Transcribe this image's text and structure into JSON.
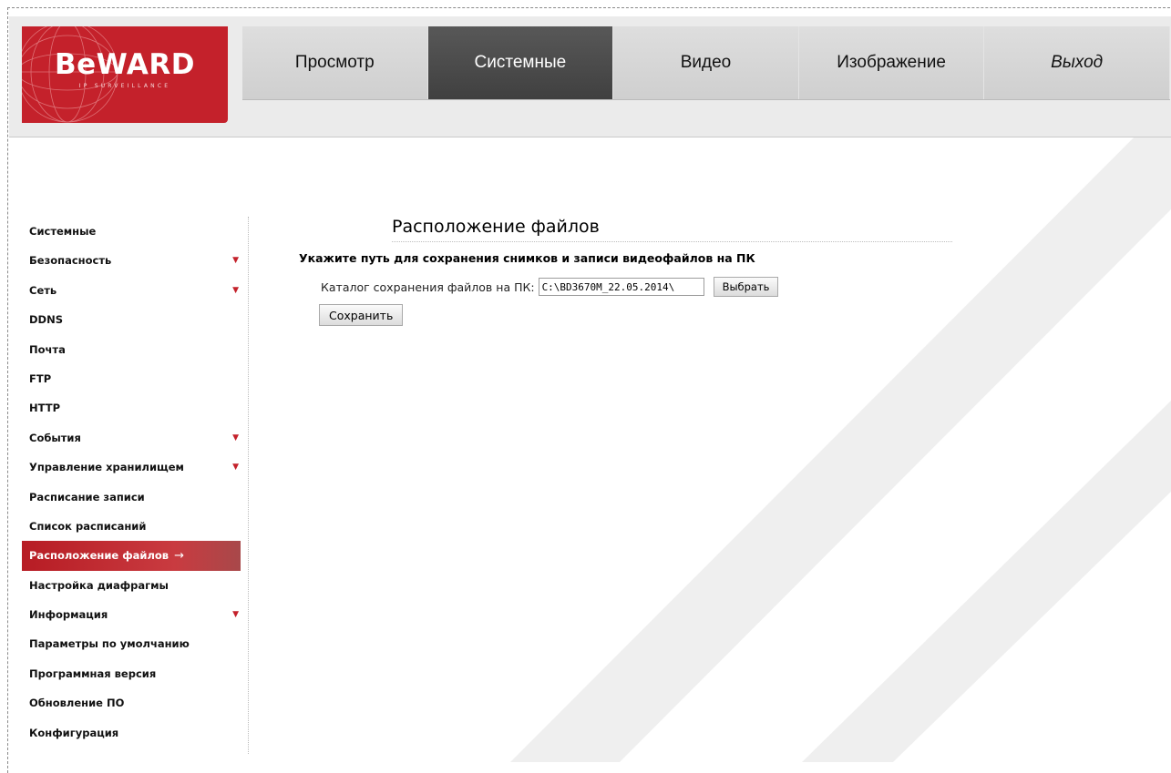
{
  "brand": {
    "logo_text": "BeWARD",
    "logo_tagline": "IP SURVEILLANCE"
  },
  "nav": {
    "tabs": [
      {
        "label": "Просмотр",
        "active": false
      },
      {
        "label": "Системные",
        "active": true
      },
      {
        "label": "Видео",
        "active": false
      },
      {
        "label": "Изображение",
        "active": false
      },
      {
        "label": "Выход",
        "active": false
      }
    ]
  },
  "sidebar": {
    "items": [
      {
        "label": "Системные",
        "has_submenu": false
      },
      {
        "label": "Безопасность",
        "has_submenu": true
      },
      {
        "label": "Сеть",
        "has_submenu": true
      },
      {
        "label": "DDNS",
        "has_submenu": false
      },
      {
        "label": "Почта",
        "has_submenu": false
      },
      {
        "label": "FTP",
        "has_submenu": false
      },
      {
        "label": "HTTP",
        "has_submenu": false
      },
      {
        "label": "События",
        "has_submenu": true
      },
      {
        "label": "Управление хранилищем",
        "has_submenu": true
      },
      {
        "label": "Расписание записи",
        "has_submenu": false
      },
      {
        "label": "Список расписаний",
        "has_submenu": false
      },
      {
        "label": "Расположение файлов",
        "has_submenu": false,
        "active": true
      },
      {
        "label": "Настройка диафрагмы",
        "has_submenu": false
      },
      {
        "label": "Информация",
        "has_submenu": true
      },
      {
        "label": "Параметры по умолчанию",
        "has_submenu": false
      },
      {
        "label": "Программная версия",
        "has_submenu": false
      },
      {
        "label": "Обновление ПО",
        "has_submenu": false
      },
      {
        "label": "Конфигурация",
        "has_submenu": false
      }
    ],
    "active_arrow": "→"
  },
  "main": {
    "title": "Расположение файлов",
    "subtitle": "Укажите путь для сохранения снимков и записи видеофайлов на ПК",
    "path_label": "Каталог сохранения файлов на ПК:",
    "path_value": "C:\\BD3670M_22.05.2014\\",
    "browse_label": "Выбрать",
    "save_label": "Сохранить"
  },
  "colors": {
    "accent": "#c4212b",
    "nav_active": "#4a4a4a",
    "nav_bg": "#d6d6d6"
  }
}
